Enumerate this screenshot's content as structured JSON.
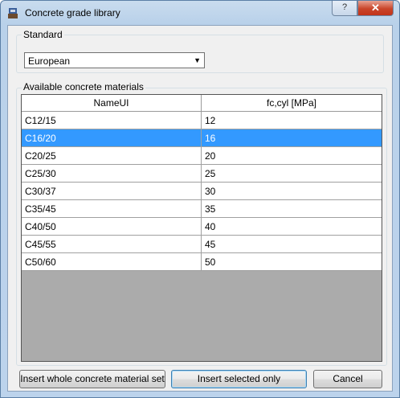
{
  "window": {
    "title": "Concrete grade library",
    "help_label": "?",
    "close_label": "✕"
  },
  "standard": {
    "group_label": "Standard",
    "selected_value": "European"
  },
  "materials": {
    "group_label": "Available concrete materials",
    "columns": [
      "NameUI",
      "fc,cyl [MPa]"
    ],
    "rows": [
      {
        "name": "C12/15",
        "fc": "12"
      },
      {
        "name": "C16/20",
        "fc": "16"
      },
      {
        "name": "C20/25",
        "fc": "20"
      },
      {
        "name": "C25/30",
        "fc": "25"
      },
      {
        "name": "C30/37",
        "fc": "30"
      },
      {
        "name": "C35/45",
        "fc": "35"
      },
      {
        "name": "C40/50",
        "fc": "40"
      },
      {
        "name": "C45/55",
        "fc": "45"
      },
      {
        "name": "C50/60",
        "fc": "50"
      }
    ],
    "selected_index": 1
  },
  "buttons": {
    "insert_all": "Insert whole concrete material set",
    "insert_selected": "Insert selected only",
    "cancel": "Cancel"
  },
  "colors": {
    "selection": "#3399ff",
    "close_button": "#c9452a"
  }
}
